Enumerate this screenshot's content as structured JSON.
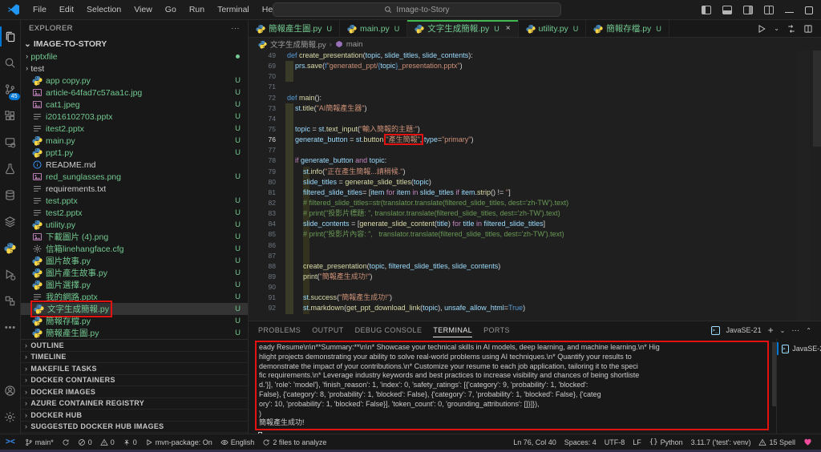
{
  "colors": {
    "accent_green": "#3fb950",
    "untracked_green": "#73c991",
    "annotation_red": "#e41111",
    "badge_blue": "#0078d4",
    "heart_pink": "#f14c9c"
  },
  "title_bar": {
    "menus": [
      "File",
      "Edit",
      "Selection",
      "View",
      "Go",
      "Run",
      "Terminal",
      "Help"
    ],
    "search_text": "Image-to-Story"
  },
  "activity_bar": {
    "items": [
      {
        "name": "explorer",
        "active": true
      },
      {
        "name": "search"
      },
      {
        "name": "source-control",
        "badge": "45"
      },
      {
        "name": "extensions"
      },
      {
        "name": "remote-explorer"
      },
      {
        "name": "testing"
      },
      {
        "name": "database"
      },
      {
        "name": "layers"
      },
      {
        "name": "python"
      },
      {
        "name": "run-debug"
      },
      {
        "name": "symbols"
      },
      {
        "name": "more"
      }
    ],
    "bottom": [
      {
        "name": "account"
      },
      {
        "name": "settings"
      }
    ]
  },
  "explorer": {
    "title": "EXPLORER",
    "project": "IMAGE-TO-STORY",
    "files": [
      {
        "label": "pptxfile",
        "type": "folder",
        "green": true,
        "dot": true
      },
      {
        "label": "test",
        "type": "folder"
      },
      {
        "label": "app copy.py",
        "type": "py",
        "badge": "U",
        "green": true
      },
      {
        "label": "article-64fad7c57aa1c.jpg",
        "type": "img",
        "badge": "U",
        "green": true
      },
      {
        "label": "cat1.jpeg",
        "type": "img",
        "badge": "U",
        "green": true
      },
      {
        "label": "i2016102703.pptx",
        "type": "pptx",
        "badge": "U",
        "green": true
      },
      {
        "label": "itest2.pptx",
        "type": "pptx",
        "badge": "U",
        "green": true
      },
      {
        "label": "main.py",
        "type": "py",
        "badge": "U",
        "green": true
      },
      {
        "label": "ppt1.py",
        "type": "py",
        "badge": "U",
        "green": true
      },
      {
        "label": "README.md",
        "type": "md"
      },
      {
        "label": "red_sunglasses.png",
        "type": "img",
        "badge": "U",
        "green": true
      },
      {
        "label": "requirements.txt",
        "type": "txt"
      },
      {
        "label": "test.pptx",
        "type": "pptx",
        "badge": "U",
        "green": true
      },
      {
        "label": "test2.pptx",
        "type": "pptx",
        "badge": "U",
        "green": true
      },
      {
        "label": "utility.py",
        "type": "py",
        "badge": "U",
        "green": true
      },
      {
        "label": "下載圖片 (4).png",
        "type": "img",
        "badge": "U",
        "green": true
      },
      {
        "label": "信箱linehangface.cfg",
        "type": "cfg",
        "badge": "U",
        "green": true
      },
      {
        "label": "圖片故事.py",
        "type": "py",
        "badge": "U",
        "green": true
      },
      {
        "label": "圖片產生故事.py",
        "type": "py",
        "badge": "U",
        "green": true
      },
      {
        "label": "圖片選擇.py",
        "type": "py",
        "badge": "U",
        "green": true
      },
      {
        "label": "我的網路.pptx",
        "type": "pptx",
        "badge": "U",
        "green": true
      },
      {
        "label": "文字生成簡報.py",
        "type": "py",
        "badge": "U",
        "green": true,
        "selected": true,
        "annotated": true
      },
      {
        "label": "簡報存檔.py",
        "type": "py",
        "badge": "U",
        "green": true
      },
      {
        "label": "簡報產生圖.py",
        "type": "py",
        "badge": "U",
        "green": true
      }
    ],
    "sections": [
      "OUTLINE",
      "TIMELINE",
      "MAKEFILE TASKS",
      "DOCKER CONTAINERS",
      "DOCKER IMAGES",
      "AZURE CONTAINER REGISTRY",
      "DOCKER HUB",
      "SUGGESTED DOCKER HUB IMAGES"
    ]
  },
  "editor": {
    "tabs": [
      {
        "label": "簡報產生圖.py",
        "badge": "U"
      },
      {
        "label": "main.py",
        "badge": "U"
      },
      {
        "label": "文字生成簡報.py",
        "badge": "U",
        "active": true,
        "close": "×"
      },
      {
        "label": "utility.py",
        "badge": "U"
      },
      {
        "label": "簡報存檔.py",
        "badge": "U"
      }
    ],
    "breadcrumb": {
      "file": "文字生成簡報.py",
      "symbol": "main"
    },
    "code_lines": [
      {
        "n": "49",
        "t": [
          [
            "k",
            "def "
          ],
          [
            "f",
            "create_presentation"
          ],
          [
            "o",
            "("
          ],
          [
            "v",
            "topic"
          ],
          [
            "o",
            ", "
          ],
          [
            "v",
            "slide_titles"
          ],
          [
            "o",
            ", "
          ],
          [
            "v",
            "slide_contents"
          ],
          [
            "o",
            "):"
          ]
        ]
      },
      {
        "n": "69",
        "g1": 1,
        "t": [
          [
            "o",
            "    "
          ],
          [
            "v",
            "prs"
          ],
          [
            "o",
            "."
          ],
          [
            "f",
            "save"
          ],
          [
            "o",
            "("
          ],
          [
            "b",
            "f"
          ],
          [
            "s",
            "\"generated_ppt/"
          ],
          [
            "b",
            "{"
          ],
          [
            "v",
            "topic"
          ],
          [
            "b",
            "}"
          ],
          [
            "s",
            "_presentation.pptx\""
          ],
          [
            "o",
            ")"
          ]
        ]
      },
      {
        "n": "70",
        "g1": 1,
        "t": []
      },
      {
        "n": "71",
        "t": []
      },
      {
        "n": "72",
        "t": [
          [
            "k",
            "def "
          ],
          [
            "f",
            "main"
          ],
          [
            "o",
            "():"
          ]
        ]
      },
      {
        "n": "73",
        "g1": 1,
        "t": [
          [
            "o",
            "    "
          ],
          [
            "v",
            "st"
          ],
          [
            "o",
            "."
          ],
          [
            "f",
            "title"
          ],
          [
            "o",
            "("
          ],
          [
            "s",
            "\"AI簡報產生器\""
          ],
          [
            "o",
            ")"
          ]
        ]
      },
      {
        "n": "74",
        "g1": 1,
        "t": []
      },
      {
        "n": "75",
        "g1": 1,
        "t": [
          [
            "o",
            "    "
          ],
          [
            "v",
            "topic"
          ],
          [
            "o",
            " = "
          ],
          [
            "v",
            "st"
          ],
          [
            "o",
            "."
          ],
          [
            "f",
            "text_input"
          ],
          [
            "o",
            "("
          ],
          [
            "s",
            "\"輸入簡報的主題:\""
          ],
          [
            "o",
            ")"
          ]
        ]
      },
      {
        "n": "76",
        "g1": 1,
        "cur": true,
        "t": [
          [
            "o",
            "    "
          ],
          [
            "v",
            "generate_button"
          ],
          [
            "o",
            " = "
          ],
          [
            "v",
            "st"
          ],
          [
            "o",
            "."
          ],
          [
            "f",
            "button"
          ],
          [
            "o",
            "("
          ],
          [
            "s",
            "\"產生簡報\"",
            1
          ],
          [
            "o",
            ",",
            1
          ],
          [
            "o",
            " "
          ],
          [
            "v",
            "type"
          ],
          [
            "o",
            "="
          ],
          [
            "s",
            "\"primary\""
          ],
          [
            "o",
            ")"
          ]
        ]
      },
      {
        "n": "77",
        "g1": 1,
        "t": []
      },
      {
        "n": "78",
        "g1": 1,
        "t": [
          [
            "o",
            "    "
          ],
          [
            "c",
            "if "
          ],
          [
            "v",
            "generate_button"
          ],
          [
            "c",
            " and "
          ],
          [
            "v",
            "topic"
          ],
          [
            "o",
            ":"
          ]
        ]
      },
      {
        "n": "79",
        "g1": 1,
        "g2": 1,
        "t": [
          [
            "o",
            "        "
          ],
          [
            "v",
            "st"
          ],
          [
            "o",
            "."
          ],
          [
            "f",
            "info"
          ],
          [
            "o",
            "("
          ],
          [
            "s",
            "\"正在產生簡報...請稍候.\""
          ],
          [
            "o",
            ")"
          ]
        ]
      },
      {
        "n": "80",
        "g1": 1,
        "g2": 1,
        "t": [
          [
            "o",
            "        "
          ],
          [
            "v",
            "slide_titles"
          ],
          [
            "o",
            " = "
          ],
          [
            "f",
            "generate_slide_titles"
          ],
          [
            "o",
            "("
          ],
          [
            "v",
            "topic"
          ],
          [
            "o",
            ")"
          ]
        ]
      },
      {
        "n": "81",
        "g1": 1,
        "g2": 1,
        "t": [
          [
            "o",
            "        "
          ],
          [
            "v",
            "filtered_slide_titles"
          ],
          [
            "o",
            "= ["
          ],
          [
            "v",
            "item"
          ],
          [
            "c",
            " for "
          ],
          [
            "v",
            "item"
          ],
          [
            "c",
            " in "
          ],
          [
            "v",
            "slide_titles"
          ],
          [
            "c",
            " if "
          ],
          [
            "v",
            "item"
          ],
          [
            "o",
            "."
          ],
          [
            "f",
            "strip"
          ],
          [
            "o",
            "() != "
          ],
          [
            "s",
            "''"
          ],
          [
            "o",
            "]"
          ]
        ]
      },
      {
        "n": "82",
        "g1": 1,
        "g2": 1,
        "t": [
          [
            "m",
            "        # filtered_slide_titles=str(translator.translate(filtered_slide_titles, dest='zh-TW').text)"
          ]
        ]
      },
      {
        "n": "83",
        "g1": 1,
        "g2": 1,
        "t": [
          [
            "m",
            "        # print(\"投影片標題: \", translator.translate(filtered_slide_titles, dest='zh-TW').text)"
          ]
        ]
      },
      {
        "n": "84",
        "g1": 1,
        "g2": 1,
        "t": [
          [
            "o",
            "        "
          ],
          [
            "v",
            "slide_contents"
          ],
          [
            "o",
            " = ["
          ],
          [
            "f",
            "generate_slide_content"
          ],
          [
            "o",
            "("
          ],
          [
            "v",
            "title"
          ],
          [
            "o",
            ")"
          ],
          [
            "c",
            " for "
          ],
          [
            "v",
            "title"
          ],
          [
            "c",
            " in "
          ],
          [
            "v",
            "filtered_slide_titles"
          ],
          [
            "o",
            "]"
          ]
        ]
      },
      {
        "n": "85",
        "g1": 1,
        "g2": 1,
        "t": [
          [
            "m",
            "        # print(\"投影片內容: \",   translator.translate(filtered_slide_titles, dest='zh-TW').text)"
          ]
        ]
      },
      {
        "n": "86",
        "g1": 1,
        "g2": 1,
        "t": []
      },
      {
        "n": "87",
        "g1": 1,
        "g2": 1,
        "t": []
      },
      {
        "n": "88",
        "g1": 1,
        "g2": 1,
        "t": [
          [
            "o",
            "        "
          ],
          [
            "f",
            "create_presentation"
          ],
          [
            "o",
            "("
          ],
          [
            "v",
            "topic"
          ],
          [
            "o",
            ", "
          ],
          [
            "v",
            "filtered_slide_titles"
          ],
          [
            "o",
            ", "
          ],
          [
            "v",
            "slide_contents"
          ],
          [
            "o",
            ")"
          ]
        ]
      },
      {
        "n": "89",
        "g1": 1,
        "g2": 1,
        "t": [
          [
            "o",
            "        "
          ],
          [
            "f",
            "print"
          ],
          [
            "o",
            "("
          ],
          [
            "s",
            "\"簡報產生成功!\""
          ],
          [
            "o",
            ")"
          ]
        ]
      },
      {
        "n": "90",
        "g1": 1,
        "g2": 1,
        "t": []
      },
      {
        "n": "91",
        "g1": 1,
        "g2": 1,
        "t": [
          [
            "o",
            "        "
          ],
          [
            "v",
            "st"
          ],
          [
            "o",
            "."
          ],
          [
            "f",
            "success"
          ],
          [
            "o",
            "("
          ],
          [
            "s",
            "\"簡報產生成功!\""
          ],
          [
            "o",
            ")"
          ]
        ]
      },
      {
        "n": "92",
        "g1": 1,
        "g2": 1,
        "t": [
          [
            "o",
            "        "
          ],
          [
            "v",
            "st"
          ],
          [
            "o",
            "."
          ],
          [
            "f",
            "markdown"
          ],
          [
            "o",
            "("
          ],
          [
            "f",
            "get_ppt_download_link"
          ],
          [
            "o",
            "("
          ],
          [
            "v",
            "topic"
          ],
          [
            "o",
            "), "
          ],
          [
            "v",
            "unsafe_allow_html"
          ],
          [
            "o",
            "="
          ],
          [
            "b",
            "True"
          ],
          [
            "o",
            ")"
          ]
        ]
      }
    ]
  },
  "panel": {
    "tabs": [
      {
        "label": "PROBLEMS"
      },
      {
        "label": "OUTPUT"
      },
      {
        "label": "DEBUG CONSOLE"
      },
      {
        "label": "TERMINAL",
        "active": true
      },
      {
        "label": "PORTS"
      }
    ],
    "terminal_profile": "JavaSE-21",
    "terminal_list_item": "JavaSE-2",
    "terminal_lines": [
      "eady Resume\\n\\n**Summary:**\\n\\n* Showcase your technical skills in AI models, deep learning, and machine learning.\\n* Hig",
      "hlight projects demonstrating your ability to solve real-world problems using AI techniques.\\n* Quantify your results to",
      "demonstrate the impact of your contributions.\\n* Customize your resume to each job application, tailoring it to the speci",
      "fic requirements.\\n* Leverage industry keywords and best practices to increase visibility and chances of being shortliste",
      "d.'}], 'role': 'model'}, 'finish_reason': 1, 'index': 0, 'safety_ratings': [{'category': 9, 'probability': 1, 'blocked':",
      "False}, {'category': 8, 'probability': 1, 'blocked': False}, {'category': 7, 'probability': 1, 'blocked': False}, {'categ",
      "ory': 10, 'probability': 1, 'blocked': False}], 'token_count': 0, 'grounding_attributions': []}]}),",
      ")",
      "簡報產生成功!"
    ]
  },
  "status_bar": {
    "left": [
      {
        "name": "git-branch",
        "icon": "branch",
        "text": "main*"
      },
      {
        "name": "sync-button",
        "icon": "sync",
        "text": ""
      },
      {
        "name": "errors",
        "icon": "error",
        "text": "0"
      },
      {
        "name": "warnings",
        "icon": "warn",
        "text": "0"
      },
      {
        "name": "ports-forwarded",
        "icon": "tower",
        "text": "0"
      },
      {
        "name": "task-mvn-package",
        "icon": "play",
        "text": "mvn-package: On"
      },
      {
        "name": "spell-language",
        "icon": "eye",
        "text": "English"
      },
      {
        "name": "files-to-analyze",
        "icon": "sync",
        "text": "2 files to analyze"
      }
    ],
    "right": [
      {
        "name": "cursor-position",
        "text": "Ln 76, Col 40"
      },
      {
        "name": "indentation",
        "text": "Spaces: 4"
      },
      {
        "name": "encoding",
        "text": "UTF-8"
      },
      {
        "name": "eol",
        "text": "LF"
      },
      {
        "name": "language-mode",
        "icon": "lang",
        "text": "Python"
      },
      {
        "name": "python-interpreter",
        "text": "3.11.7 ('test': venv)"
      },
      {
        "name": "spell-issues",
        "icon": "warn",
        "text": "15 Spell"
      },
      {
        "name": "heart",
        "icon": "heart",
        "text": ""
      }
    ]
  }
}
